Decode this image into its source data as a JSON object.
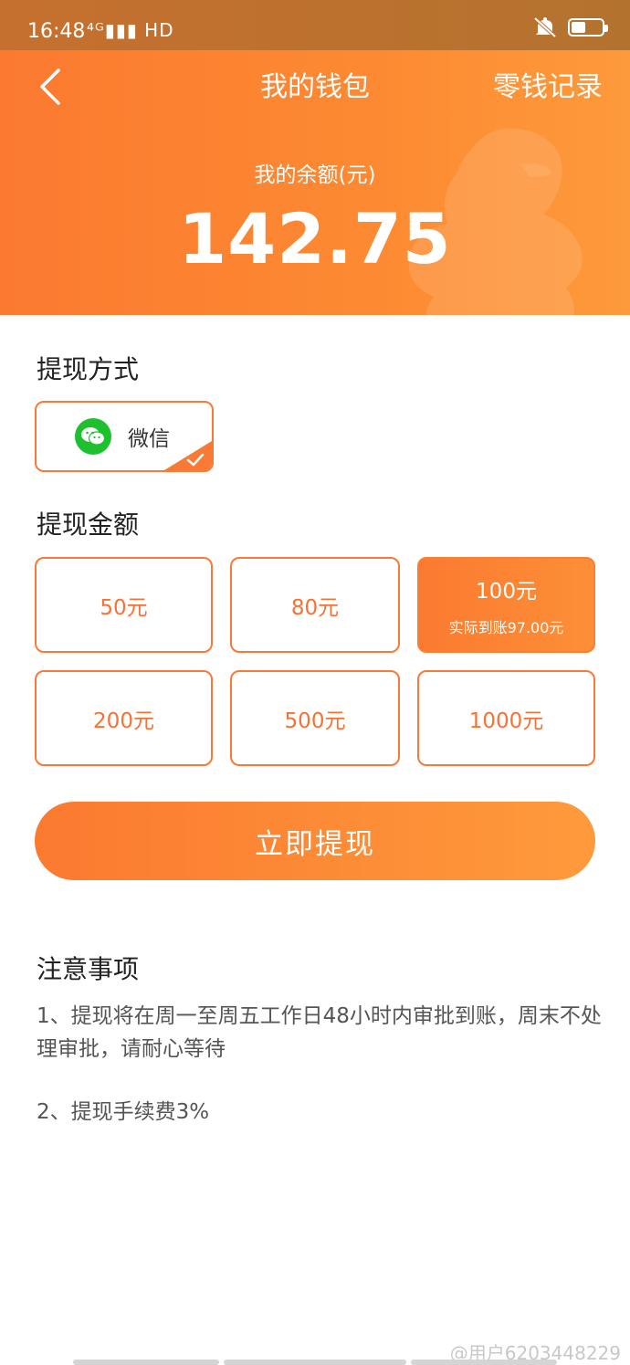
{
  "status_bar": {
    "time": "16:48",
    "signal": "⁴ᴳ▮▮▮ HD",
    "icons": [
      "mute-icon",
      "battery-icon"
    ]
  },
  "header": {
    "title": "我的钱包",
    "records_link": "零钱记录",
    "balance_label": "我的余额(元)",
    "balance_value": "142.75",
    "back_icon": "chevron-left-icon",
    "gradient": [
      "#fb7a30",
      "#fd9a3b"
    ]
  },
  "method_section": {
    "title": "提现方式",
    "method_label": "微信",
    "icon": "wechat-icon",
    "selected": true
  },
  "amount_section": {
    "title": "提现金额",
    "options": [
      {
        "label": "50元",
        "sub": ""
      },
      {
        "label": "80元",
        "sub": ""
      },
      {
        "label": "100元",
        "sub": "实际到账97.00元"
      },
      {
        "label": "200元",
        "sub": ""
      },
      {
        "label": "500元",
        "sub": ""
      },
      {
        "label": "1000元",
        "sub": ""
      }
    ],
    "selected_index": 2
  },
  "withdraw_button": "立即提现",
  "notice": {
    "title": "注意事项",
    "items": [
      "1、提现将在周一至周五工作日48小时内审批到账，周末不处理审批，请耐心等待",
      "2、提现手续费3%"
    ]
  },
  "watermark": "@用户6203448229",
  "colors": {
    "accent": "#f97a36",
    "wechat_green": "#1fc02f"
  }
}
